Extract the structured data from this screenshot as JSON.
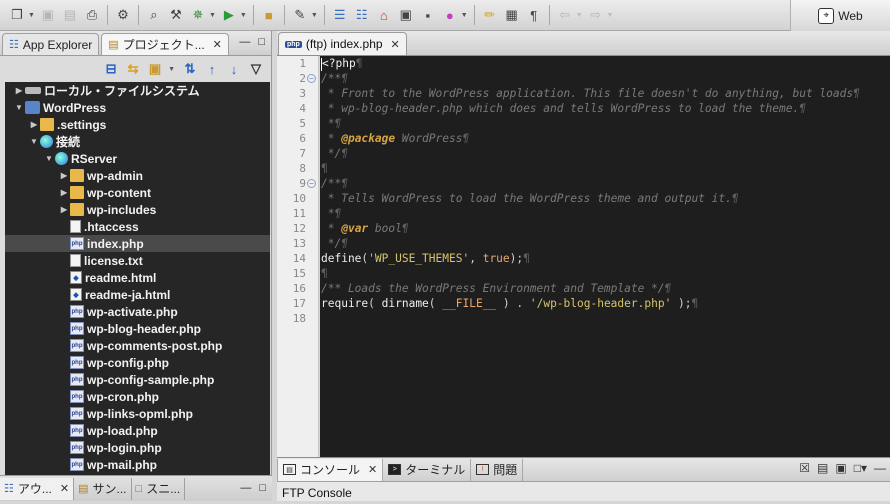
{
  "toolbar": {
    "buttons": [
      "new-icon",
      "save-icon",
      "save-all-icon",
      "print-icon",
      "settings-icon",
      "search-icon",
      "build-icon",
      "debug-icon",
      "run-icon",
      "open-folder-icon",
      "pin-icon",
      "outline-icon",
      "hierarchy-icon",
      "home-icon",
      "photo-icon",
      "terminal-icon",
      "color-icon",
      "pencil-icon",
      "grid-icon",
      "paragraph-icon",
      "back-icon",
      "forward-icon"
    ],
    "perspective_label": "Web"
  },
  "left_panel": {
    "tabs": [
      {
        "label": "App Explorer",
        "icon": "app-explorer-icon",
        "active": false
      },
      {
        "label": "プロジェクト...",
        "icon": "project-icon",
        "active": true
      }
    ],
    "tree": [
      {
        "label": "ローカル・ファイルシステム",
        "depth": 0,
        "type": "disk",
        "expanded": false
      },
      {
        "label": "WordPress",
        "depth": 0,
        "type": "wp",
        "expanded": true
      },
      {
        "label": ".settings",
        "depth": 1,
        "type": "folder",
        "expanded": false
      },
      {
        "label": "接続",
        "depth": 1,
        "type": "globe",
        "expanded": true
      },
      {
        "label": "RServer",
        "depth": 2,
        "type": "globe",
        "expanded": true
      },
      {
        "label": "wp-admin",
        "depth": 3,
        "type": "folder",
        "expanded": false
      },
      {
        "label": "wp-content",
        "depth": 3,
        "type": "folder",
        "expanded": false
      },
      {
        "label": "wp-includes",
        "depth": 3,
        "type": "folder",
        "expanded": false
      },
      {
        "label": ".htaccess",
        "depth": 3,
        "type": "txt"
      },
      {
        "label": "index.php",
        "depth": 3,
        "type": "php",
        "selected": true
      },
      {
        "label": "license.txt",
        "depth": 3,
        "type": "txt"
      },
      {
        "label": "readme.html",
        "depth": 3,
        "type": "html"
      },
      {
        "label": "readme-ja.html",
        "depth": 3,
        "type": "html"
      },
      {
        "label": "wp-activate.php",
        "depth": 3,
        "type": "php"
      },
      {
        "label": "wp-blog-header.php",
        "depth": 3,
        "type": "php"
      },
      {
        "label": "wp-comments-post.php",
        "depth": 3,
        "type": "php"
      },
      {
        "label": "wp-config.php",
        "depth": 3,
        "type": "php"
      },
      {
        "label": "wp-config-sample.php",
        "depth": 3,
        "type": "php"
      },
      {
        "label": "wp-cron.php",
        "depth": 3,
        "type": "php"
      },
      {
        "label": "wp-links-opml.php",
        "depth": 3,
        "type": "php"
      },
      {
        "label": "wp-load.php",
        "depth": 3,
        "type": "php"
      },
      {
        "label": "wp-login.php",
        "depth": 3,
        "type": "php"
      },
      {
        "label": "wp-mail.php",
        "depth": 3,
        "type": "php"
      }
    ],
    "bottom_tabs": [
      {
        "label": "アウ...",
        "active": true
      },
      {
        "label": "サン..."
      },
      {
        "label": "スニ..."
      }
    ]
  },
  "editor": {
    "tab_label": "(ftp) index.php",
    "line_numbers": [
      "1",
      "2",
      "3",
      "4",
      "5",
      "6",
      "7",
      "8",
      "9",
      "10",
      "11",
      "12",
      "13",
      "14",
      "15",
      "16",
      "17",
      "18"
    ],
    "fold_lines": [
      2,
      9
    ]
  },
  "console": {
    "tabs": [
      {
        "label": "コンソール",
        "active": true
      },
      {
        "label": "ターミナル"
      },
      {
        "label": "問題"
      }
    ],
    "title": "FTP Console"
  },
  "colors": {
    "editor_bg": "#1e1e1e",
    "tree_bg": "#262626",
    "comment": "#7a7a7a",
    "annotation": "#d8a440",
    "string": "#d6c46a"
  }
}
